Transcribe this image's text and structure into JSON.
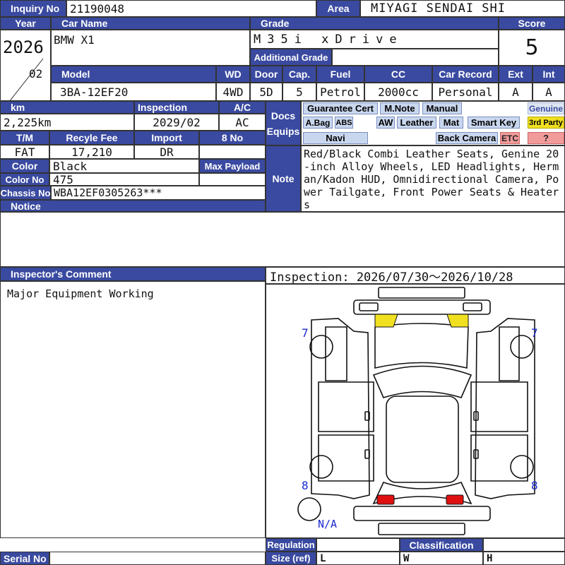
{
  "labels": {
    "inquiry_no": "Inquiry No",
    "area": "Area",
    "year": "Year",
    "car_name": "Car Name",
    "grade": "Grade",
    "score": "Score",
    "additional_grade": "Additional Grade",
    "model": "Model",
    "wd": "WD",
    "door": "Door",
    "cap": "Cap.",
    "fuel": "Fuel",
    "cc": "CC",
    "car_record": "Car Record",
    "ext": "Ext",
    "int": "Int",
    "km": "km",
    "inspection": "Inspection",
    "ac": "A/C",
    "docs": "Docs",
    "equips": "Equips",
    "tm": "T/M",
    "recycle_fee": "Recyle Fee",
    "import": "Import",
    "eight_no": "8 No",
    "color": "Color",
    "max_payload": "Max Payload",
    "color_no": "Color No",
    "note": "Note",
    "chassis_no": "Chassis No",
    "notice": "Notice",
    "inspectors_comment": "Inspector's Comment",
    "regulation": "Regulation",
    "classification": "Classification",
    "size_ref": "Size (ref)",
    "serial_no": "Serial No"
  },
  "values": {
    "inquiry_no": "21190048",
    "area": "MIYAGI SENDAI SHI",
    "year": "2026",
    "year_month": "02",
    "car_name": "BMW X1",
    "grade": "M35i xDrive",
    "score": "5",
    "model": "3BA-12EF20",
    "wd": "4WD",
    "door": "5D",
    "cap": "5",
    "fuel": "Petrol",
    "cc": "2000cc",
    "car_record": "Personal",
    "ext": "A",
    "int": "A",
    "km": "2,225km",
    "inspection": "2029/02",
    "ac": "AC",
    "tm": "FAT",
    "recycle_fee": "17,210",
    "import": "DR",
    "color": "Black",
    "color_no": "475",
    "chassis_no": "WBA12EF0305263***",
    "note": "Red/Black Combi Leather Seats, Genine 20-inch Alloy Wheels, LED Headlights, Herman/Kadon HUD, Omnidirectional Camera, Power Tailgate, Front Power Seats & Heaters",
    "inspector_comment": "Major Equipment Working",
    "inspection_period": "Inspection: 2026/07/30〜2026/10/28",
    "size_l": "L",
    "size_w": "W",
    "size_h": "H"
  },
  "equipment": {
    "guarantee_cert": "Guarantee Cert",
    "m_note": "M.Note",
    "manual": "Manual",
    "genuine": "Genuine",
    "a_bag": "A.Bag",
    "abs": "ABS",
    "aw": "AW",
    "leather": "Leather",
    "mat": "Mat",
    "smart_key": "Smart Key",
    "third_party": "3rd Party",
    "navi": "Navi",
    "back_camera": "Back Camera",
    "etc": "ETC",
    "unknown": "?"
  },
  "diagram": {
    "tire_front_left": "7",
    "tire_front_right": "7",
    "tire_rear_left": "8",
    "tire_rear_right": "8",
    "spare": "N/A"
  },
  "colors": {
    "header": "#3a4aa0",
    "tag": "#c9d7ee",
    "highlight_yellow": "#f0e020",
    "highlight_red": "#f29b9b",
    "diagram_front": "#f0e020",
    "diagram_rear": "#e01010",
    "diagram_label": "#1a2ad0"
  }
}
